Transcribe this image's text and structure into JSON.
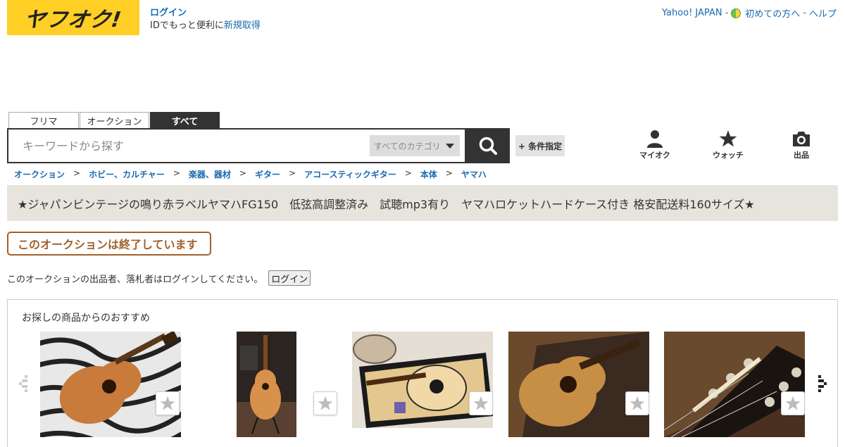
{
  "header": {
    "logo_text": "ヤフオク!",
    "login_label": "ログイン",
    "id_text": "IDでもっと便利に",
    "signup_label": "新規取得",
    "links": [
      "Yahoo! JAPAN",
      "初めての方へ",
      "ヘルプ"
    ],
    "sep": "-"
  },
  "search": {
    "tabs": [
      "フリマ",
      "オークション",
      "すべて"
    ],
    "active_tab": 2,
    "placeholder": "キーワードから探す",
    "category_label": "すべてのカテゴリ",
    "conditions_label": "+ 条件指定"
  },
  "nav": {
    "items": [
      {
        "label": "マイオク",
        "icon": "person-icon"
      },
      {
        "label": "ウォッチ",
        "icon": "star-icon"
      },
      {
        "label": "出品",
        "icon": "camera-icon"
      }
    ]
  },
  "breadcrumb": [
    "オークション",
    "ホビー、カルチャー",
    "楽器、器材",
    "ギター",
    "アコースティックギター",
    "本体",
    "ヤマハ"
  ],
  "breadcrumb_sep": ">",
  "item": {
    "title": "★ジャパンビンテージの鳴り赤ラベルヤマハFG150　低弦高調整済み　試聴mp3有り　ヤマハロケットハードケース付き 格安配送料160サイズ★",
    "ended_label": "このオークションは終了しています",
    "login_notice": "このオークションの出品者、落札者はログインしてください。",
    "login_button": "ログイン"
  },
  "recommend": {
    "title": "お探しの商品からのおすすめ",
    "cards": [
      {
        "name": "guitar-zebra-photo"
      },
      {
        "name": "guitar-stand-photo"
      },
      {
        "name": "guitar-case-photo"
      },
      {
        "name": "guitar-brown-case-photo"
      },
      {
        "name": "guitar-headstock-photo"
      }
    ]
  },
  "colors": {
    "brand_yellow": "#ffcf26",
    "link_blue": "#1a6ab0",
    "ended_brown": "#a0612d",
    "title_bar_bg": "#e6e4dd"
  }
}
